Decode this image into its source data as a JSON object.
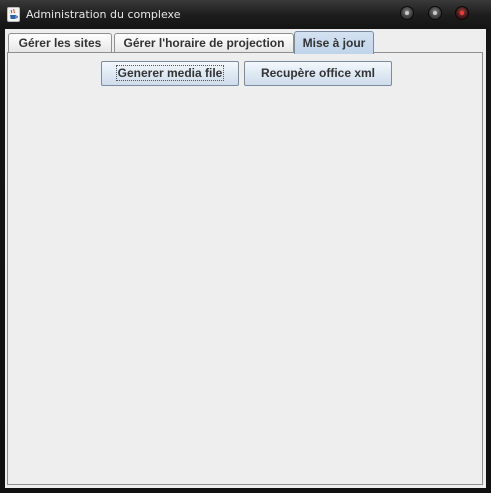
{
  "window": {
    "title": "Administration du complexe",
    "icon": "java-coffee-cup-icon"
  },
  "tabs": [
    {
      "label": "Gérer les sites",
      "selected": false
    },
    {
      "label": "Gérer l'horaire de projection",
      "selected": false
    },
    {
      "label": "Mise à jour",
      "selected": true
    }
  ],
  "panel": {
    "buttons": [
      {
        "label": "Generer media file",
        "focused": true
      },
      {
        "label": "Recupère office xml",
        "focused": false
      }
    ]
  },
  "colors": {
    "titlebar": "#1e1e1e",
    "selected_tab": "#c8d9ec",
    "background": "#eeeeee",
    "close_button": "#ff3a3a"
  }
}
